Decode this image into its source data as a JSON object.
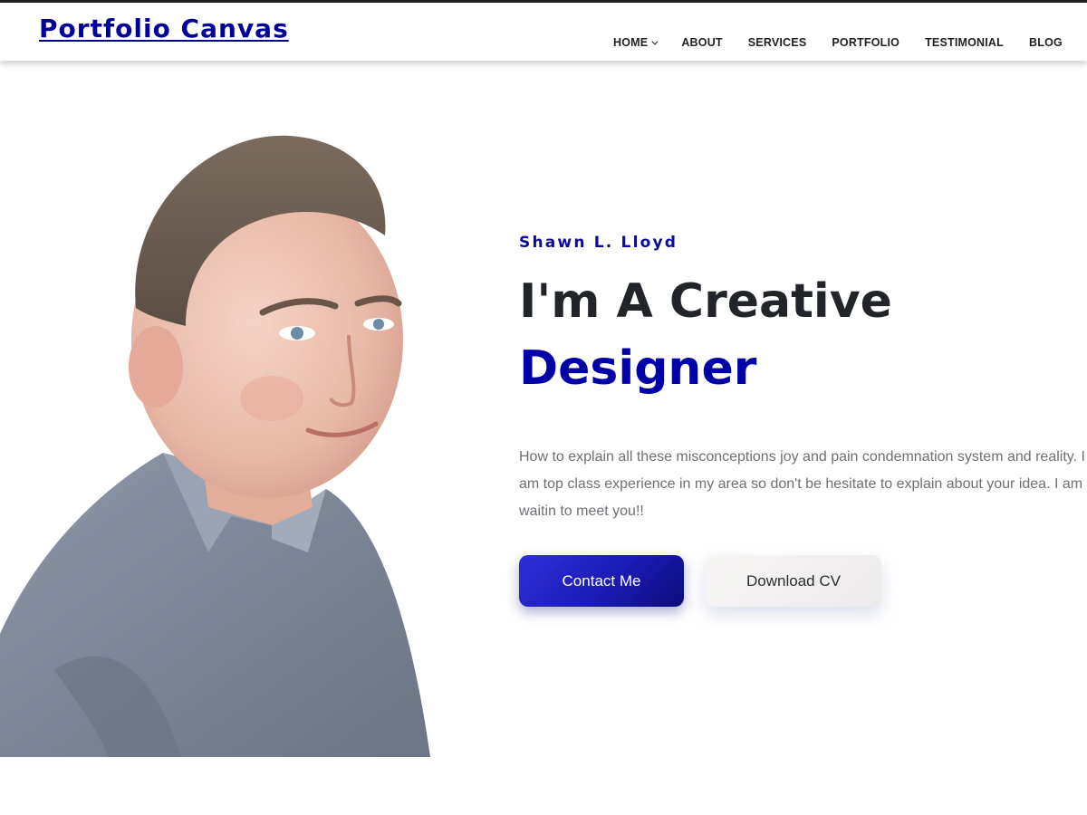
{
  "header": {
    "brand": "Portfolio Canvas",
    "nav": [
      {
        "label": "HOME",
        "has_dropdown": true
      },
      {
        "label": "ABOUT"
      },
      {
        "label": "SERVICES"
      },
      {
        "label": "PORTFOLIO"
      },
      {
        "label": "TESTIMONIAL"
      },
      {
        "label": "BLOG"
      }
    ]
  },
  "hero": {
    "name": "Shawn L. Lloyd",
    "title_line1": "I'm A Creative",
    "title_line2": "Designer",
    "description": "How to explain all these misconceptions joy and pain condemnation system and reality. I am top class experience in my area so don't be hesitate to explain about your idea. I am waitin to meet you!!",
    "primary_button": "Contact Me",
    "secondary_button": "Download CV"
  },
  "colors": {
    "brand": "#00009a",
    "accent": "#0000a8",
    "heading": "#212428",
    "body_text": "#6f6f75"
  }
}
